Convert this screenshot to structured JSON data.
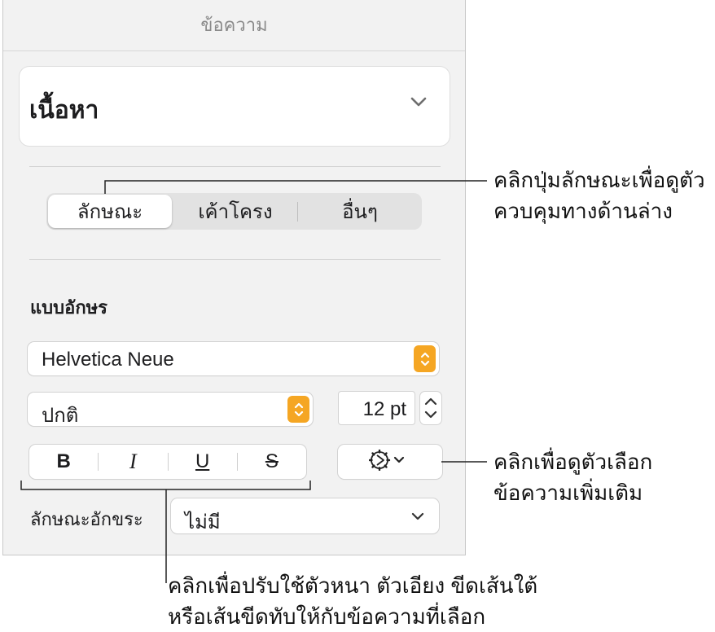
{
  "panel": {
    "title": "ข้อความ",
    "paragraph_style": {
      "label": "เนื้อหา"
    },
    "tabs": [
      {
        "label": "ลักษณะ",
        "active": true
      },
      {
        "label": "เค้าโครง",
        "active": false
      },
      {
        "label": "อื่นๆ",
        "active": false
      }
    ],
    "font_section_label": "แบบอักษร",
    "font_family": "Helvetica Neue",
    "font_style": "ปกติ",
    "font_size": "12 pt",
    "format_buttons": {
      "bold": "B",
      "italic": "I",
      "underline": "U",
      "strikethrough": "S"
    },
    "gear_icon": "gear-icon",
    "character_style_label": "ลักษณะอักขระ",
    "character_style_value": "ไม่มี"
  },
  "callouts": {
    "tabs": [
      "คลิกปุ่มลักษณะเพื่อดูตัว",
      "ควบคุมทางด้านล่าง"
    ],
    "gear": [
      "คลิกเพื่อดูตัวเลือก",
      "ข้อความเพิ่มเติม"
    ],
    "format": [
      "คลิกเพื่อปรับใช้ตัวหนา ตัวเอียง ขีดเส้นใต้",
      "หรือเส้นขีดทับให้กับข้อความที่เลือก"
    ]
  },
  "colors": {
    "accent": "#f5a623",
    "panel_bg": "#f2f2f2"
  }
}
